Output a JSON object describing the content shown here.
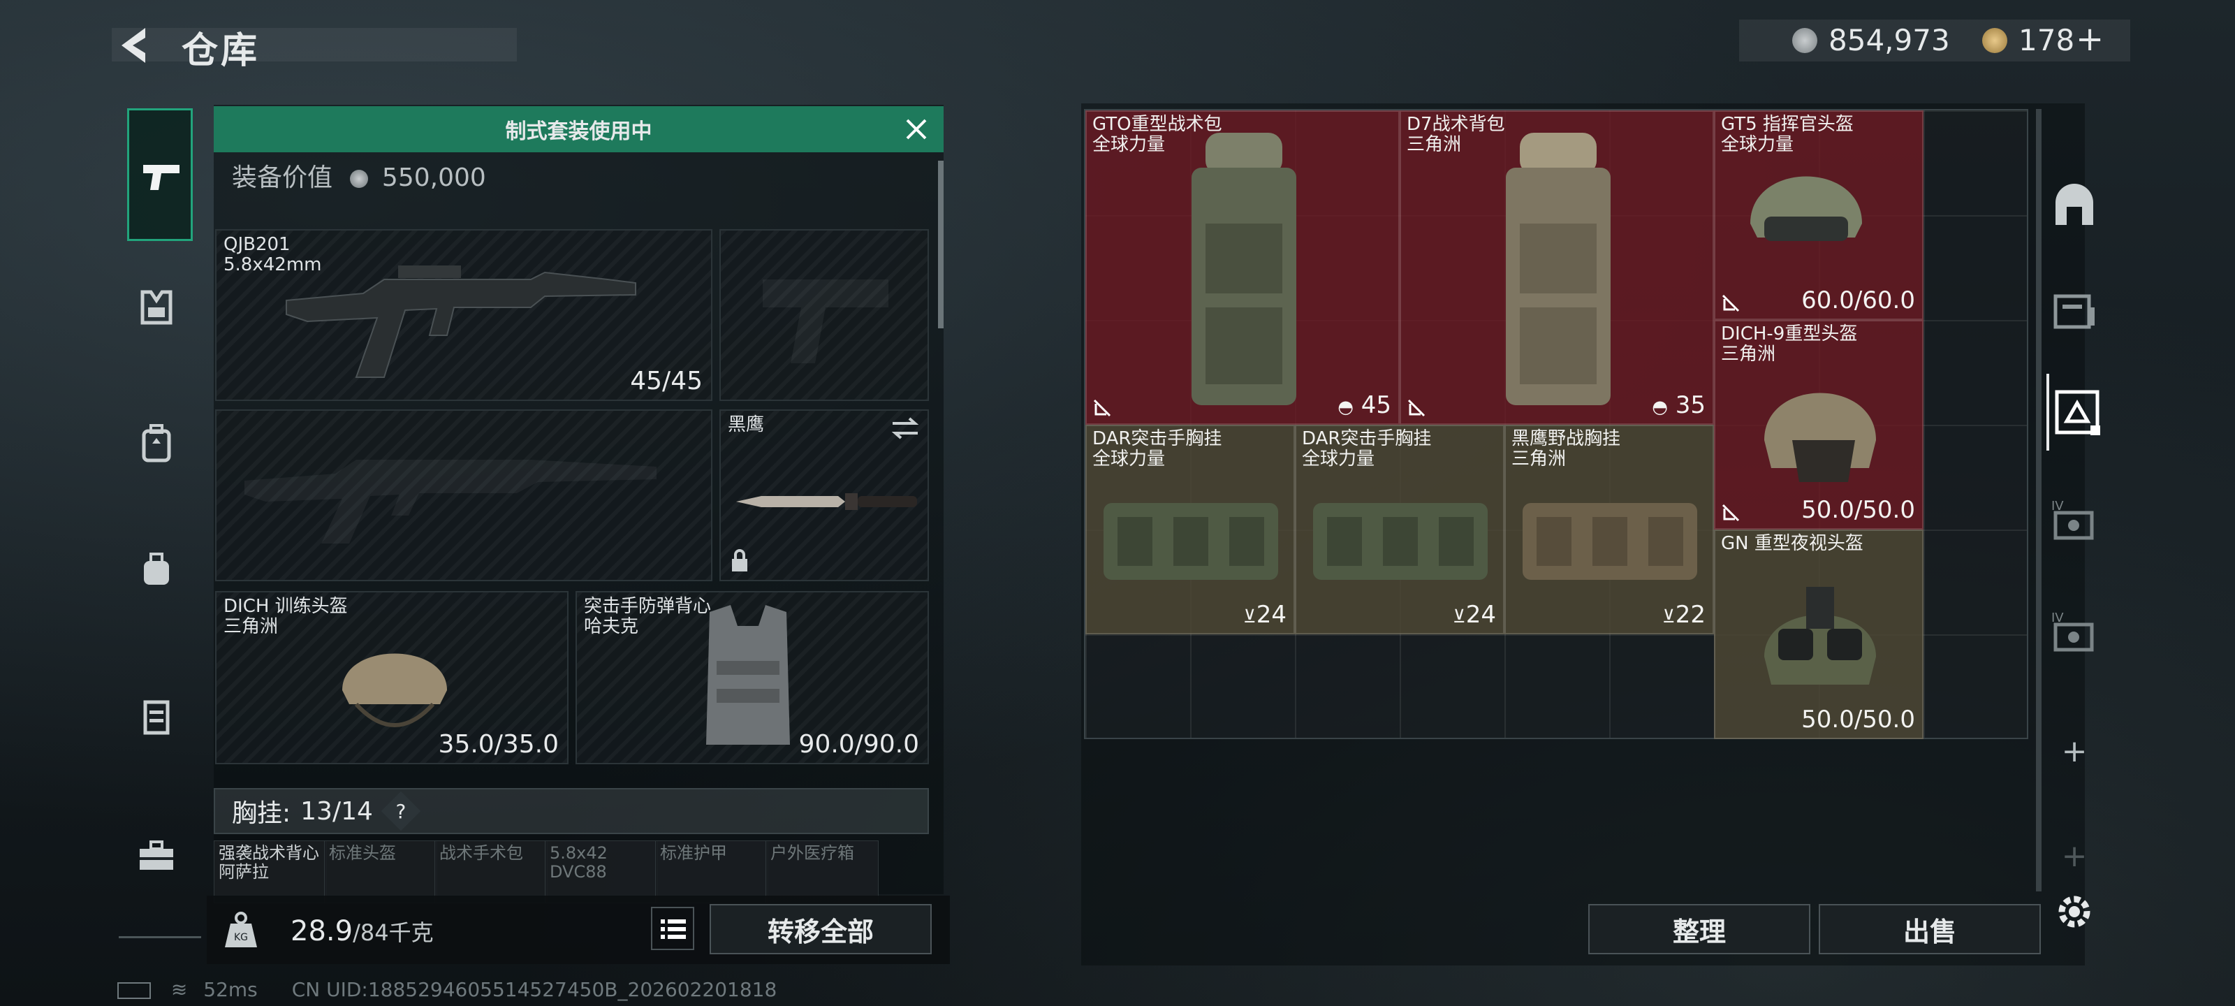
{
  "header": {
    "title": "仓库",
    "currency_coins": "854,973",
    "currency_gold": "178",
    "currency_plus": "+"
  },
  "loadout": {
    "banner": "制式套装使用中",
    "value_label": "装备价值",
    "value": "550,000",
    "slots": [
      {
        "name": "QJB201",
        "sub": "5.8x42mm",
        "count": "45/45"
      },
      {
        "name": "",
        "sub": "",
        "count": ""
      },
      {
        "name": "",
        "sub": "",
        "count": ""
      },
      {
        "name": "黑鹰",
        "sub": "",
        "count": ""
      },
      {
        "name": "DICH 训练头盔",
        "sub": "三角洲",
        "count": "35.0/35.0"
      },
      {
        "name": "突击手防弹背心",
        "sub": "哈夫克",
        "count": "90.0/90.0"
      }
    ],
    "chest_label": "胸挂:",
    "chest_value": "13/14",
    "chest_help": "?",
    "mini_tabs": [
      {
        "l1": "强袭战术背心",
        "l2": "阿萨拉"
      },
      {
        "l1": "标准头盔",
        "l2": ""
      },
      {
        "l1": "战术手术包",
        "l2": ""
      },
      {
        "l1": "5.8x42",
        "l2": "DVC88"
      },
      {
        "l1": "标准护甲",
        "l2": ""
      },
      {
        "l1": "户外医疗箱",
        "l2": ""
      }
    ],
    "weight_value": "28.9",
    "weight_total": "/84千克",
    "transfer_label": "转移全部"
  },
  "stash": {
    "items": [
      {
        "name": "GTO重型战术包",
        "sub": "全球力量",
        "count": "45",
        "tint": "red"
      },
      {
        "name": "D7战术背包",
        "sub": "三角洲",
        "count": "35",
        "tint": "red"
      },
      {
        "name": "GT5 指挥官头盔",
        "sub": "全球力量",
        "count": "60.0/60.0",
        "tint": "red"
      },
      {
        "name": "DICH-9重型头盔",
        "sub": "三角洲",
        "count": "50.0/50.0",
        "tint": "red"
      },
      {
        "name": "DAR突击手胸挂",
        "sub": "全球力量",
        "count": "24",
        "tint": "olive"
      },
      {
        "name": "DAR突击手胸挂",
        "sub": "全球力量",
        "count": "24",
        "tint": "olive"
      },
      {
        "name": "黑鹰野战胸挂",
        "sub": "三角洲",
        "count": "22",
        "tint": "olive"
      },
      {
        "name": "GN 重型夜视头盔",
        "sub": "",
        "count": "50.0/50.0",
        "tint": "olive"
      }
    ],
    "sort_label": "整理",
    "sell_label": "出售"
  },
  "side_icons": [
    "arch-icon",
    "folder-icon",
    "warehouse-icon",
    "storage-iv-icon",
    "storage-iv-icon-2",
    "plus-icon",
    "plus-icon-dim",
    "gear-icon"
  ],
  "footer": {
    "ping": "52ms",
    "uid": "CN UID:1885294605514527450B_202602201818"
  },
  "colors": {
    "accent_green": "#1e7a5c",
    "red_tint": "#6e1923",
    "olive_tint": "#4e4834"
  }
}
